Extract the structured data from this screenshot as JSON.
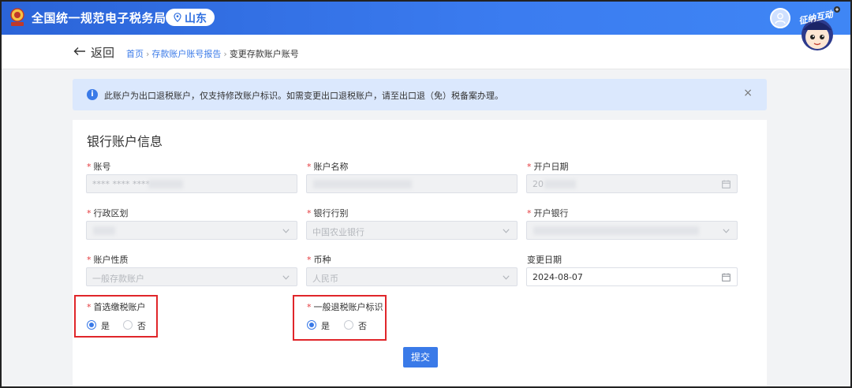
{
  "header": {
    "app_title": "全国统一规范电子税务局",
    "region": "山东",
    "mascot_text": "征纳互动"
  },
  "breadcrumb": {
    "back_label": "返回",
    "items": [
      "首页",
      "存款账户账号报告",
      "变更存款账户账号"
    ]
  },
  "notice": {
    "message": "此账户为出口退税账户，仅支持修改账户标识。如需变更出口退税账户，请至出口退（免）税备案办理。",
    "close": "×"
  },
  "form": {
    "title": "银行账户信息",
    "fields": {
      "account_no": {
        "label": "账号",
        "value": "**** **** ****"
      },
      "account_name": {
        "label": "账户名称",
        "value": ""
      },
      "open_date": {
        "label": "开户日期",
        "value": "20"
      },
      "admin_region": {
        "label": "行政区划",
        "value": ""
      },
      "bank_type": {
        "label": "银行行别",
        "value": "中国农业银行"
      },
      "open_bank": {
        "label": "开户银行",
        "value": ""
      },
      "account_nature": {
        "label": "账户性质",
        "value": "一般存款账户"
      },
      "currency": {
        "label": "币种",
        "value": "人民币"
      },
      "change_date": {
        "label": "变更日期",
        "value": "2024-08-07"
      }
    },
    "preferred_tax_account": {
      "label": "首选缴税账户",
      "options": [
        "是",
        "否"
      ],
      "selected": "是"
    },
    "general_refund_flag": {
      "label": "一般退税账户标识",
      "options": [
        "是",
        "否"
      ],
      "selected": "是"
    },
    "submit_label": "提交"
  },
  "colors": {
    "primary": "#3a7ae8",
    "header_bg": "#2f6fe0",
    "required": "#e4393c",
    "highlight": "#e0262a",
    "notice_bg": "#dbe8fd"
  }
}
